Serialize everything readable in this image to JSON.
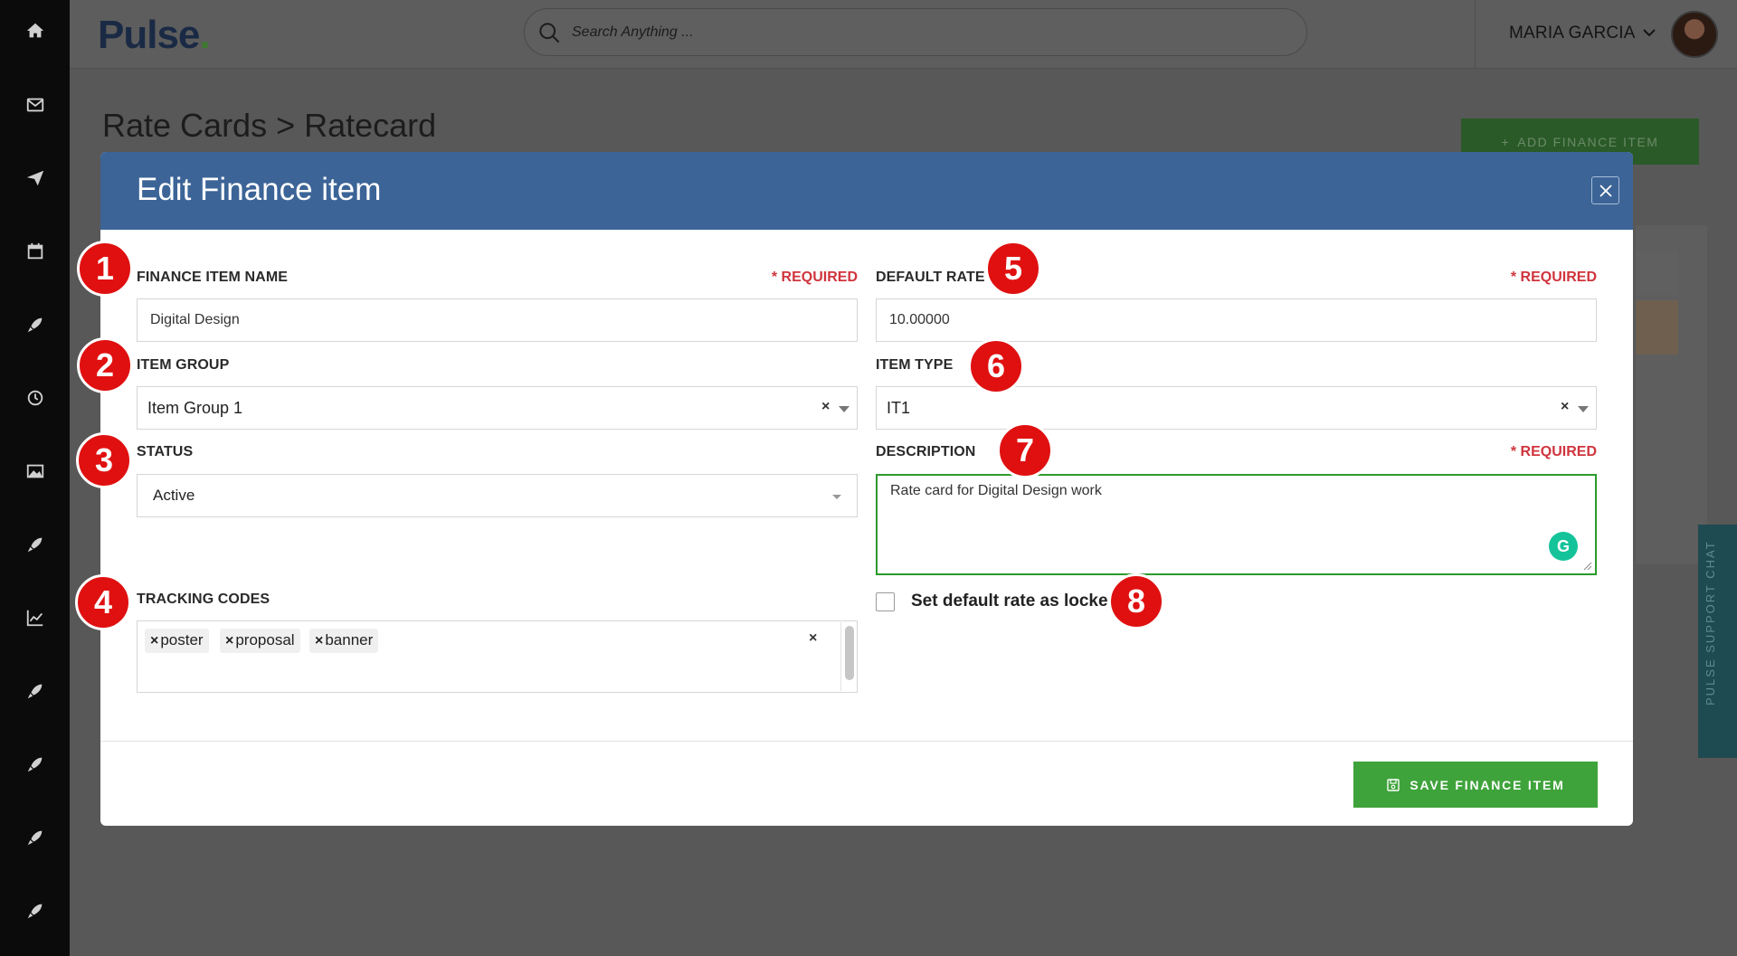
{
  "app": {
    "logo": "Pulse",
    "search_placeholder": "Search Anything ...",
    "user_name": "MARIA GARCIA"
  },
  "sidebar": {
    "icons": [
      "home-icon",
      "mail-icon",
      "send-icon",
      "calendar-icon",
      "rocket-icon",
      "clock-icon",
      "image-icon",
      "rocket-icon",
      "chart-icon",
      "rocket-icon",
      "rocket-icon",
      "rocket-icon",
      "rocket-icon"
    ]
  },
  "page": {
    "breadcrumb": "Rate Cards > Ratecard",
    "add_button": "ADD FINANCE ITEM",
    "support_chat": "PULSE SUPPORT CHAT"
  },
  "modal": {
    "title": "Edit Finance item",
    "required_text": "* REQUIRED",
    "finance_item_name": {
      "label": "FINANCE ITEM NAME",
      "value": "Digital Design"
    },
    "item_group": {
      "label": "ITEM GROUP",
      "value": "Item Group 1"
    },
    "status": {
      "label": "STATUS",
      "value": "Active"
    },
    "tracking_codes": {
      "label": "TRACKING CODES",
      "tags": [
        "poster",
        "proposal",
        "banner"
      ]
    },
    "default_rate": {
      "label": "DEFAULT RATE",
      "value": "10.00000"
    },
    "item_type": {
      "label": "ITEM TYPE",
      "value": "IT1"
    },
    "description": {
      "label": "DESCRIPTION",
      "value": "Rate card for Digital Design work"
    },
    "lock_checkbox": {
      "label": "Set default rate as locked",
      "checked": false
    },
    "save_button": "SAVE FINANCE ITEM",
    "clear_symbol": "×"
  },
  "markers": [
    "1",
    "2",
    "3",
    "4",
    "5",
    "6",
    "7",
    "8"
  ],
  "colors": {
    "modal_header": "#3c6497",
    "save_green": "#3fa33b",
    "required_red": "#d0343d",
    "marker_red": "#e01010"
  }
}
